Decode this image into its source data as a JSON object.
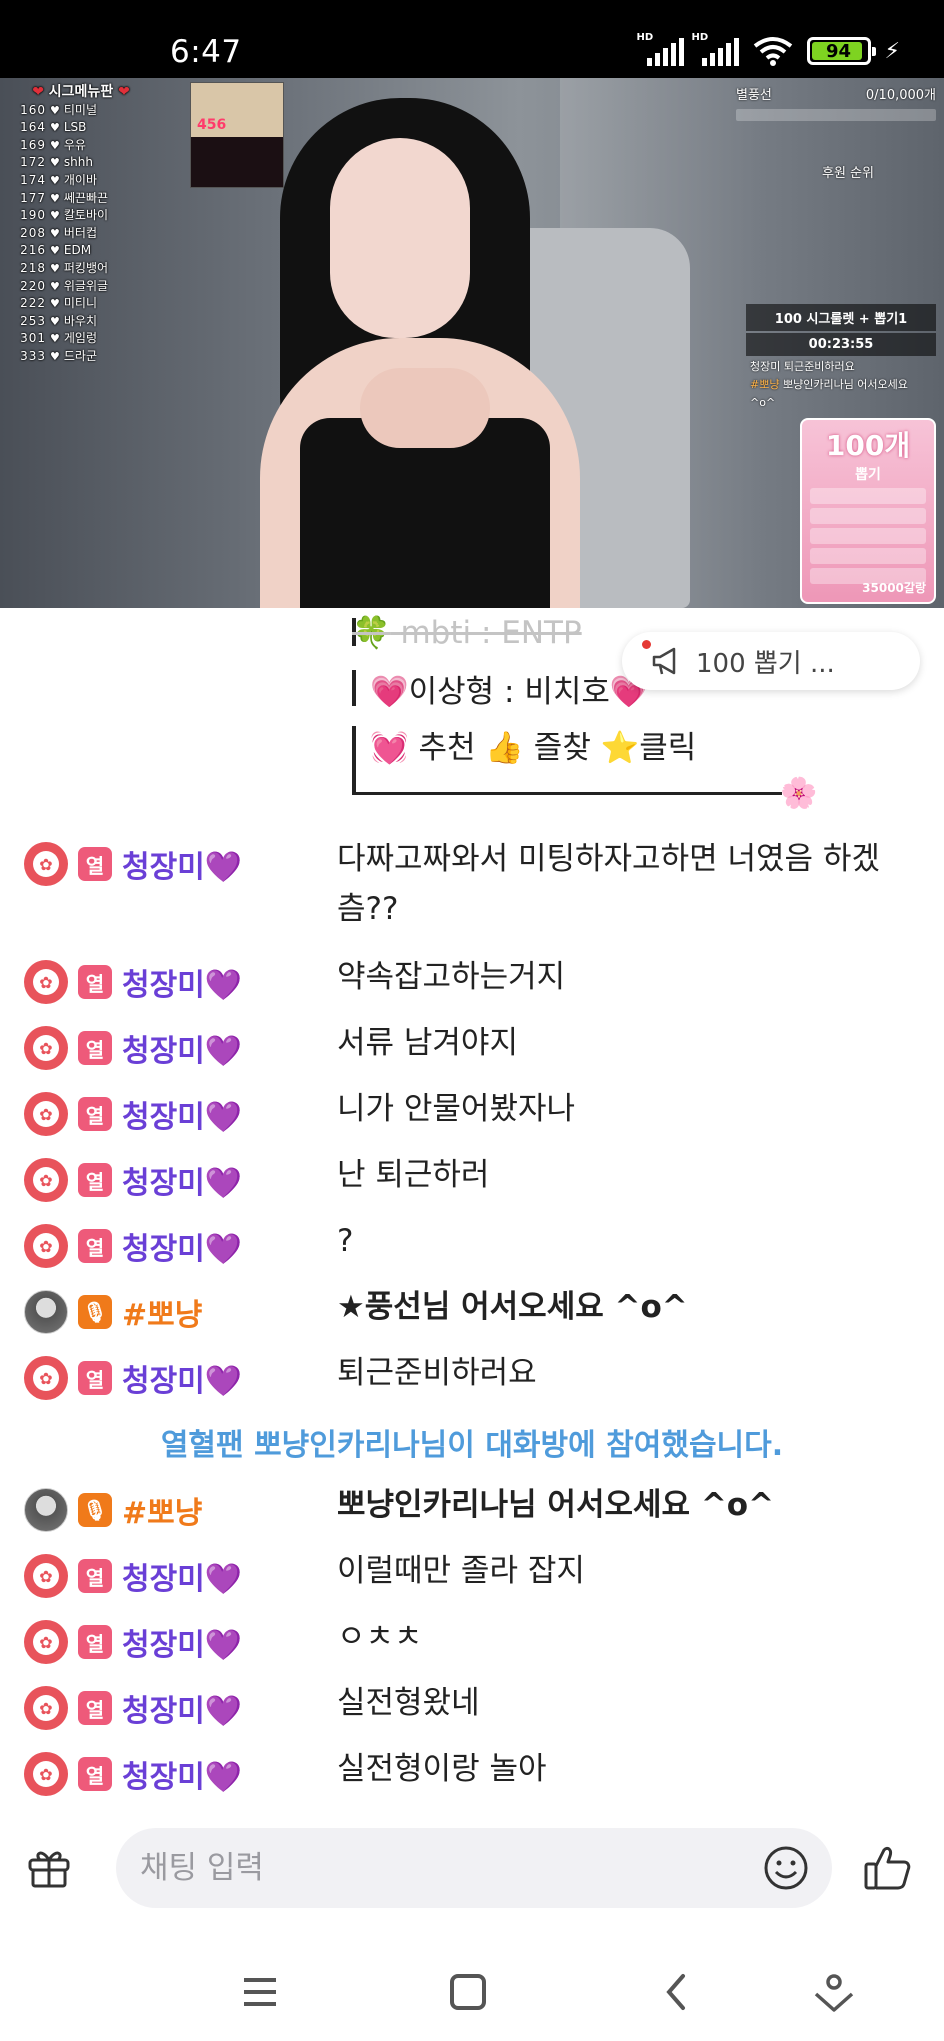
{
  "status_bar": {
    "time": "6:47",
    "battery": "94",
    "network_1": "HD",
    "network_2": "HD"
  },
  "stream": {
    "leaderboard": {
      "title": "시그메뉴판",
      "items": [
        {
          "num": "160",
          "name": "티미널"
        },
        {
          "num": "164",
          "name": "LSB"
        },
        {
          "num": "169",
          "name": "우유"
        },
        {
          "num": "172",
          "name": "shhh"
        },
        {
          "num": "174",
          "name": "개이바"
        },
        {
          "num": "177",
          "name": "쎄끈빠끈"
        },
        {
          "num": "190",
          "name": "칼토바이"
        },
        {
          "num": "208",
          "name": "버터컵"
        },
        {
          "num": "216",
          "name": "EDM"
        },
        {
          "num": "218",
          "name": "퍼킹뱅어"
        },
        {
          "num": "220",
          "name": "위글위글"
        },
        {
          "num": "222",
          "name": "미티니"
        },
        {
          "num": "253",
          "name": "바우치"
        },
        {
          "num": "301",
          "name": "게임렁"
        },
        {
          "num": "333",
          "name": "드라군"
        }
      ]
    },
    "thumb_number": "456",
    "balloon_label": "별풍선",
    "balloon_goal": "0/10,000개",
    "donor_rank": "후원 순위",
    "roulette_title": "100 시그룰렛 + 뽑기1",
    "roulette_timer": "00:23:55",
    "roulette_line_1": "청장미 퇴근준비하러요",
    "roulette_line_2_nick": "#뽀냥",
    "roulette_line_2_text": "뽀냥인카리나님 어서오세요",
    "roulette_line_3": "^o^",
    "pink_box": {
      "title": "100개",
      "subtitle": "뽑기",
      "footer": "35000갈랑"
    }
  },
  "notice": {
    "line_1": "mbti : ENTP",
    "line_2": "이상형 : 비치호",
    "line_3": "추천 👍 즐찾 ⭐클릭"
  },
  "pinned": {
    "text": "100 뽑기 ..."
  },
  "chat": {
    "messages": [
      {
        "nick": "청장미💜",
        "tag": "열",
        "text": "다짜고짜와서 미팅하자고하면 너였음 하겠츰??"
      },
      {
        "nick": "청장미💜",
        "tag": "열",
        "text": "약속잡고하는거지"
      },
      {
        "nick": "청장미💜",
        "tag": "열",
        "text": "서류 남겨야지"
      },
      {
        "nick": "청장미💜",
        "tag": "열",
        "text": "니가 안물어봤자나"
      },
      {
        "nick": "청장미💜",
        "tag": "열",
        "text": "난 퇴근하러"
      },
      {
        "nick": "청장미💜",
        "tag": "열",
        "text": "?"
      },
      {
        "nick": "#뽀냥",
        "tag": "🎙",
        "text": "★풍선님 어서오세요 ^o^"
      },
      {
        "nick": "청장미💜",
        "tag": "열",
        "text": "퇴근준비하러요"
      },
      {
        "system": "열혈팬 뽀냥인카리나님이 대화방에 참여했습니다."
      },
      {
        "nick": "#뽀냥",
        "tag": "🎙",
        "text": "뽀냥인카리나님 어서오세요 ^o^"
      },
      {
        "nick": "청장미💜",
        "tag": "열",
        "text": "이럴때만 졸라 잡지"
      },
      {
        "nick": "청장미💜",
        "tag": "열",
        "text": "ㅇㅊㅊ"
      },
      {
        "nick": "청장미💜",
        "tag": "열",
        "text": "실전형왔네"
      },
      {
        "nick": "청장미💜",
        "tag": "열",
        "text": "실전형이랑 놀아"
      }
    ]
  },
  "input": {
    "placeholder": "채팅 입력"
  }
}
